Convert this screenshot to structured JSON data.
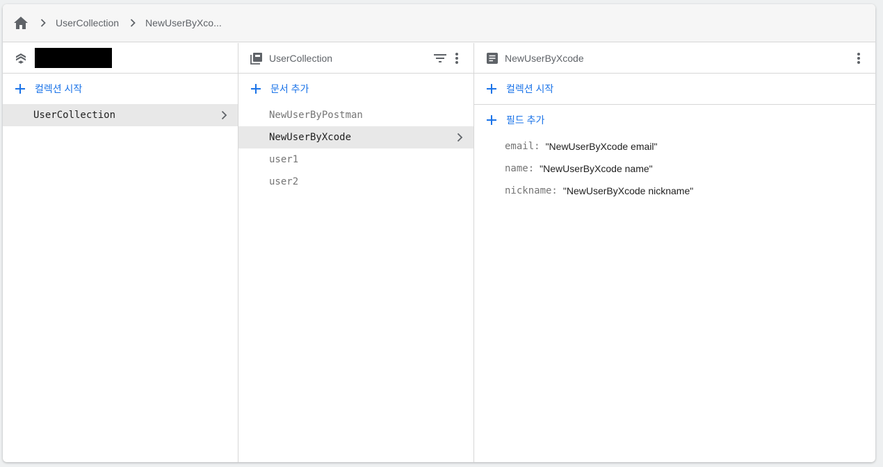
{
  "breadcrumb": {
    "home_icon": "home-icon",
    "items": [
      "UserCollection",
      "NewUserByXco..."
    ]
  },
  "root_panel": {
    "icon": "firestore-stack-icon",
    "start_collection_label": "컬렉션 시작",
    "collections": [
      {
        "name": "UserCollection",
        "selected": true
      }
    ]
  },
  "collection_panel": {
    "icon": "collection-icon",
    "title": "UserCollection",
    "add_document_label": "문서 추가",
    "documents": [
      {
        "id": "NewUserByPostman",
        "selected": false
      },
      {
        "id": "NewUserByXcode",
        "selected": true
      },
      {
        "id": "user1",
        "selected": false
      },
      {
        "id": "user2",
        "selected": false
      }
    ]
  },
  "document_panel": {
    "icon": "document-icon",
    "title": "NewUserByXcode",
    "start_collection_label": "컬렉션 시작",
    "add_field_label": "필드 추가",
    "fields": [
      {
        "key": "email:",
        "value": "\"NewUserByXcode email\""
      },
      {
        "key": "name:",
        "value": "\"NewUserByXcode name\""
      },
      {
        "key": "nickname:",
        "value": "\"NewUserByXcode nickname\""
      }
    ]
  },
  "colors": {
    "accent": "#1a73e8",
    "selected_row": "#e8e8e8",
    "muted_text": "#757575"
  }
}
